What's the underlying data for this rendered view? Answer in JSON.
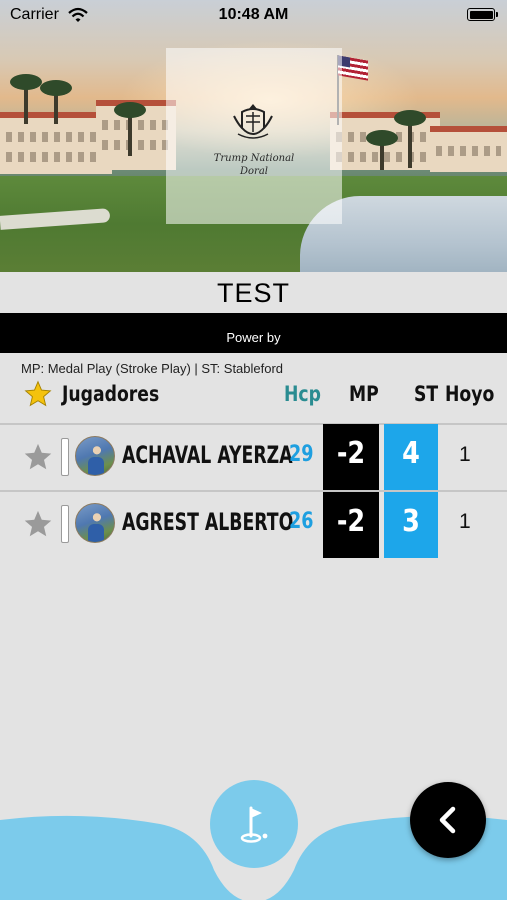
{
  "status_bar": {
    "carrier": "Carrier",
    "time": "10:48 AM"
  },
  "header_image": {
    "logo_text_line1": "Trump National",
    "logo_text_line2": "Doral"
  },
  "event": {
    "title": "TEST",
    "power_label": "Power by"
  },
  "legend_note": "MP: Medal Play (Stroke Play) | ST: Stableford",
  "table": {
    "columns": {
      "players": "Jugadores",
      "hcp": "Hcp",
      "mp": "MP",
      "st": "ST",
      "hole": "Hoyo"
    },
    "rows": [
      {
        "name": "ACHAVAL AYERZA",
        "hcp": "29",
        "mp": "-2",
        "st": "4",
        "hole": "1"
      },
      {
        "name": "AGREST ALBERTO",
        "hcp": "26",
        "mp": "-2",
        "st": "3",
        "hole": "1"
      }
    ]
  },
  "colors": {
    "hcp_header": "#2a8c91",
    "hcp_value": "#1e9fe0",
    "st_column": "#1da6ea",
    "mp_column": "#000000",
    "bottom_bar": "#7ccbeb",
    "favorite_star_active": "#f4c20d",
    "favorite_star_inactive": "#9a9a9a"
  },
  "icons": {
    "header_star": "star-icon",
    "row_favorite": "star-outline-icon",
    "course_button": "golf-flag-icon",
    "back_button": "chevron-left-icon"
  }
}
